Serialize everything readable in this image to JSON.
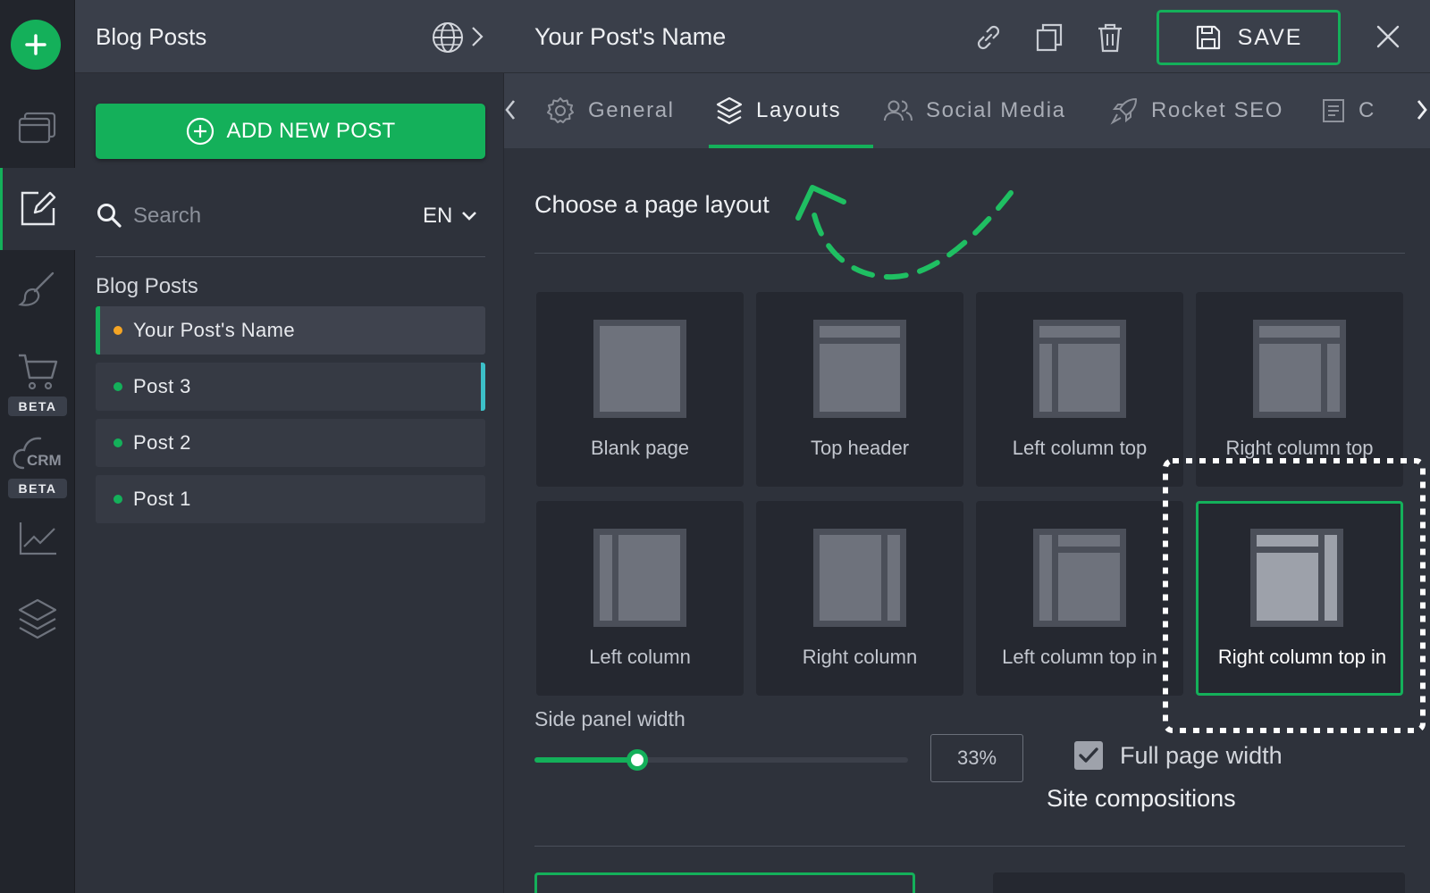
{
  "rail": {
    "badges": [
      "BETA",
      "BETA"
    ],
    "crm_label": "CRM"
  },
  "panel": {
    "title": "Blog Posts",
    "add_button": "ADD NEW POST",
    "search_placeholder": "Search",
    "language": "EN",
    "list_title": "Blog Posts",
    "posts": [
      {
        "label": "Your Post's Name",
        "status_color": "#f5a524"
      },
      {
        "label": "Post 3",
        "status_color": "#14b05a"
      },
      {
        "label": "Post 2",
        "status_color": "#14b05a"
      },
      {
        "label": "Post 1",
        "status_color": "#14b05a"
      }
    ]
  },
  "editor": {
    "title": "Your Post's Name",
    "save_label": "SAVE",
    "tabs": [
      {
        "label": "General",
        "icon": "gear-icon"
      },
      {
        "label": "Layouts",
        "icon": "layers-icon",
        "active": true
      },
      {
        "label": "Social Media",
        "icon": "users-icon"
      },
      {
        "label": "Rocket SEO",
        "icon": "rocket-icon"
      },
      {
        "label": "C",
        "icon": "document-icon"
      }
    ],
    "section_title": "Choose a page layout",
    "layouts": [
      "Blank page",
      "Top header",
      "Left column top",
      "Right column top",
      "Left column",
      "Right column",
      "Left column top in",
      "Right column top in"
    ],
    "selected_layout": "Right column top in",
    "side_panel_label": "Side panel width",
    "side_panel_value": "33%",
    "side_panel_fraction": 0.275,
    "full_width_label": "Full page width",
    "full_width_checked": true,
    "compositions_title": "Site compositions"
  },
  "colors": {
    "accent": "#14b05a",
    "hover_marker": "#3cc0c8",
    "pending_dot": "#f5a524"
  }
}
